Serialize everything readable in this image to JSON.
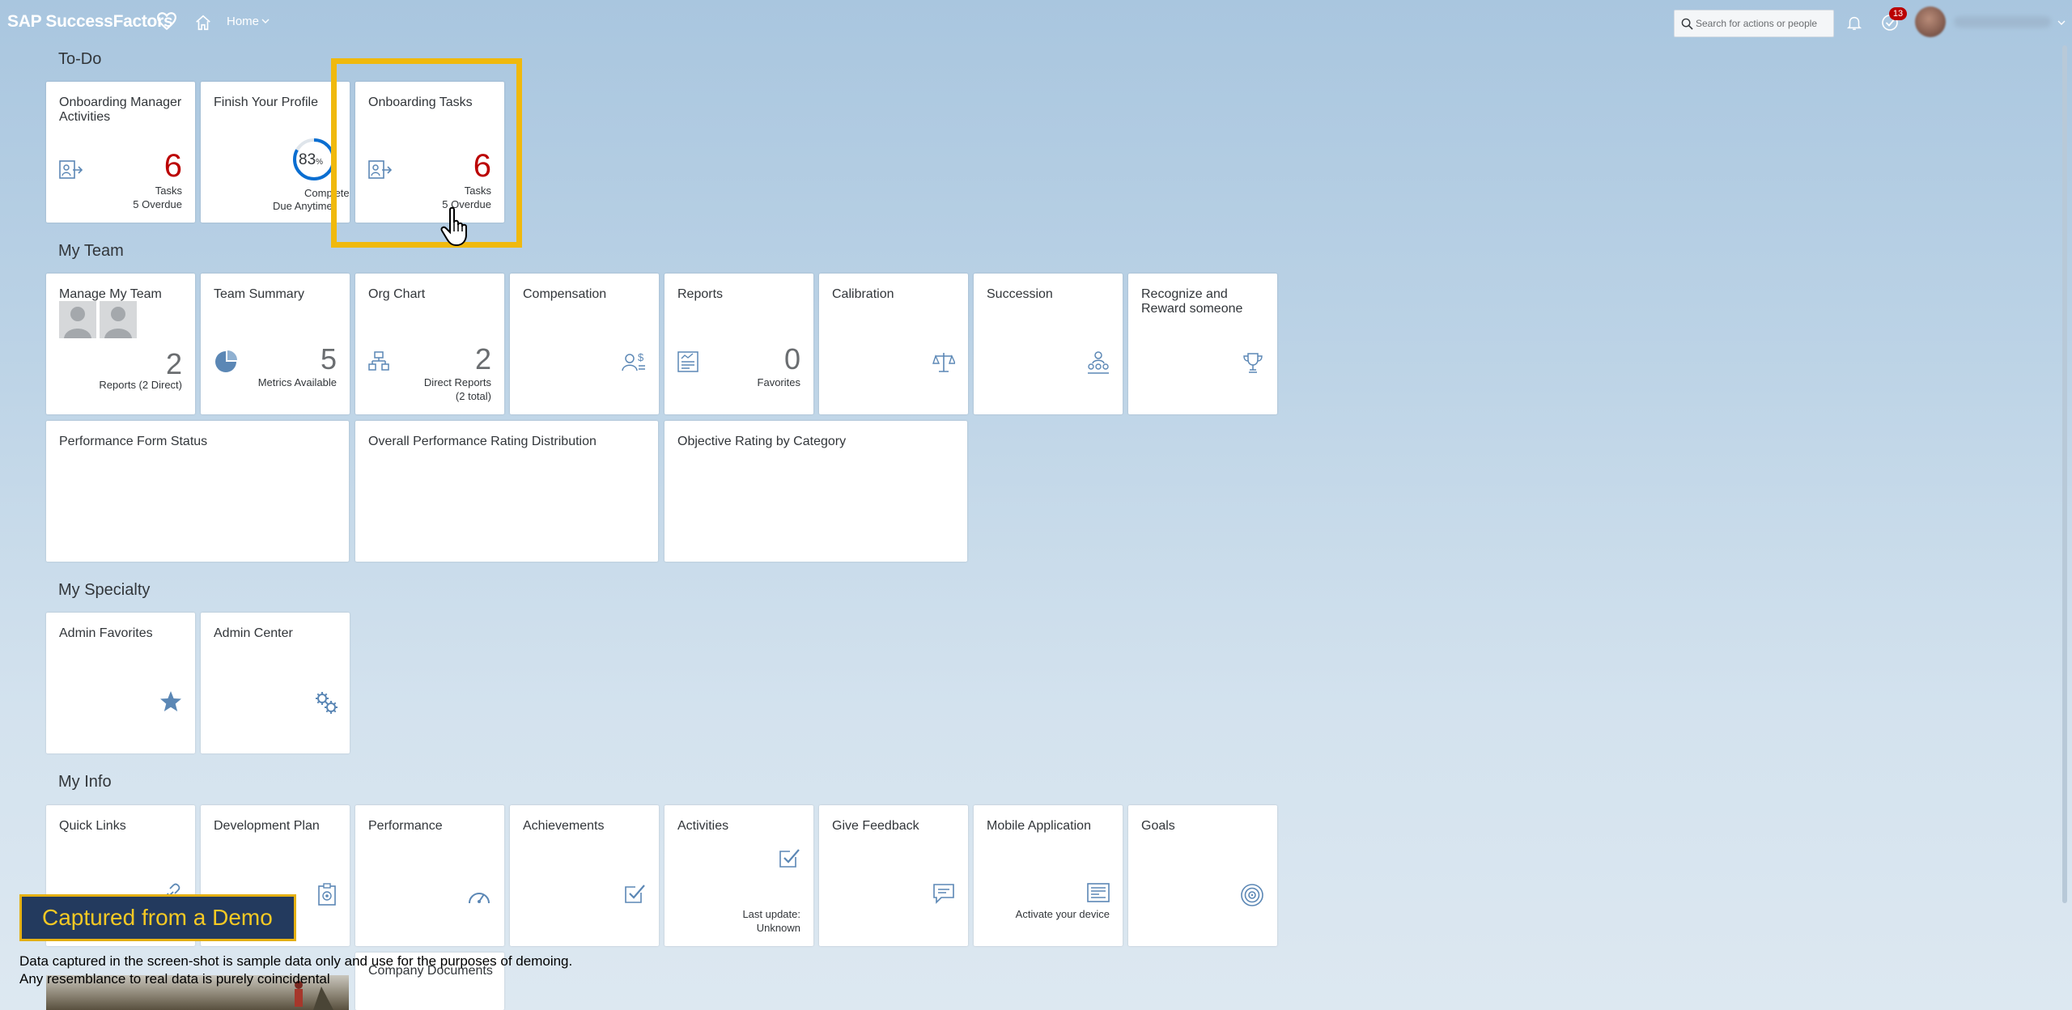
{
  "header": {
    "logo_text": "SAP SuccessFactors",
    "home_label": "Home",
    "search_placeholder": "Search for actions or people",
    "notification_badge": "13"
  },
  "sections": {
    "todo": "To-Do",
    "team": "My Team",
    "specialty": "My Specialty",
    "info": "My Info"
  },
  "todo": {
    "onboarding_manager": {
      "title": "Onboarding Manager Activities",
      "count": "6",
      "unit": "Tasks",
      "overdue": "5 Overdue"
    },
    "profile": {
      "title": "Finish Your Profile",
      "percent": "83",
      "percent_unit": "%",
      "status": "Completed",
      "due": "Due Anytime",
      "progress": 0.83
    },
    "onboarding_tasks": {
      "title": "Onboarding Tasks",
      "count": "6",
      "unit": "Tasks",
      "overdue": "5 Overdue"
    }
  },
  "team": {
    "manage": {
      "title": "Manage My Team",
      "count": "2",
      "sub": "Reports (2 Direct)"
    },
    "summary": {
      "title": "Team Summary",
      "count": "5",
      "sub": "Metrics Available"
    },
    "org": {
      "title": "Org Chart",
      "count": "2",
      "sub1": "Direct Reports",
      "sub2": "(2 total)"
    },
    "compensation": {
      "title": "Compensation"
    },
    "reports": {
      "title": "Reports",
      "count": "0",
      "sub": "Favorites"
    },
    "calibration": {
      "title": "Calibration"
    },
    "succession": {
      "title": "Succession"
    },
    "recognize": {
      "title": "Recognize and Reward someone"
    },
    "perf_form": {
      "title": "Performance Form Status"
    },
    "overall_rating": {
      "title": "Overall Performance Rating Distribution"
    },
    "objective_rating": {
      "title": "Objective Rating by Category"
    }
  },
  "specialty": {
    "admin_fav": {
      "title": "Admin Favorites"
    },
    "admin_center": {
      "title": "Admin Center"
    }
  },
  "info": {
    "quick_links": {
      "title": "Quick Links"
    },
    "dev_plan": {
      "title": "Development Plan"
    },
    "performance": {
      "title": "Performance"
    },
    "achievements": {
      "title": "Achievements"
    },
    "activities": {
      "title": "Activities",
      "sub1": "Last update:",
      "sub2": "Unknown"
    },
    "feedback": {
      "title": "Give Feedback"
    },
    "mobile": {
      "title": "Mobile Application",
      "sub": "Activate your device"
    },
    "goals": {
      "title": "Goals"
    },
    "company_docs": {
      "title": "Company Documents"
    }
  },
  "overlay": {
    "banner": "Captured from a Demo",
    "line1": "Data captured in the screen-shot is sample data only and use for the purposes of demoing.",
    "line2": "Any resemblance to real data is purely coincidental"
  },
  "colors": {
    "accent": "#0a6ed1",
    "alert": "#bb0000",
    "highlight": "#f0b90d",
    "banner_bg": "#233a5e",
    "icon": "#5b87b5"
  }
}
